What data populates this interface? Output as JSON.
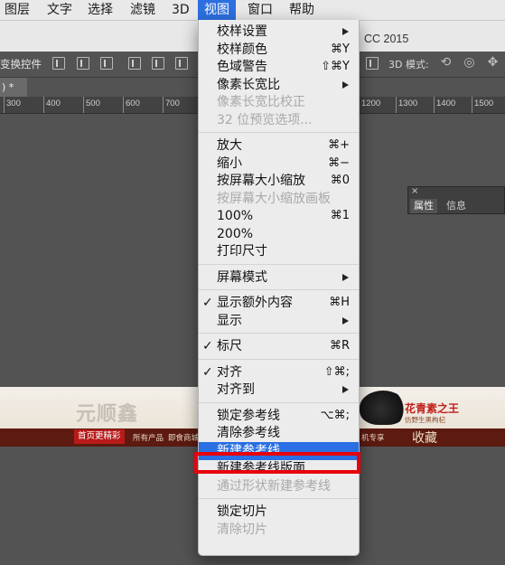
{
  "menubar": {
    "items": [
      "图层",
      "文字",
      "选择",
      "滤镜",
      "3D",
      "视图",
      "窗口",
      "帮助"
    ],
    "active_index": 5
  },
  "app_title": "CC 2015",
  "options_bar": {
    "transform_label": "变换控件",
    "mode3d_label": "3D 模式:"
  },
  "doc_tab": ") *",
  "ruler": {
    "labels": [
      "300",
      "400",
      "500",
      "600",
      "700",
      "1200",
      "1300",
      "1400",
      "1500"
    ]
  },
  "panel": {
    "tabs": [
      "属性",
      "信息"
    ],
    "active_index": 0,
    "close_glyph": "×"
  },
  "canvas_image": {
    "logo": "元顺鑫",
    "slogan": "花青素之王",
    "sub": "仿野生黑枸杞",
    "nav_first": "首页更精彩",
    "nav_links": [
      "所有产品",
      "即食商城",
      "机专享"
    ],
    "collect": "收藏"
  },
  "menu": {
    "items": [
      {
        "label": "校样设置",
        "submenu": true
      },
      {
        "label": "校样颜色",
        "shortcut": "⌘Y"
      },
      {
        "label": "色域警告",
        "shortcut": "⇧⌘Y"
      },
      {
        "label": "像素长宽比",
        "submenu": true
      },
      {
        "label": "像素长宽比校正",
        "disabled": true
      },
      {
        "label": "32 位预览选项...",
        "disabled": true
      },
      {
        "separator": true
      },
      {
        "label": "放大",
        "shortcut": "⌘+"
      },
      {
        "label": "缩小",
        "shortcut": "⌘−"
      },
      {
        "label": "按屏幕大小缩放",
        "shortcut": "⌘0"
      },
      {
        "label": "按屏幕大小缩放画板",
        "disabled": true
      },
      {
        "label": "100%",
        "shortcut": "⌘1"
      },
      {
        "label": "200%"
      },
      {
        "label": "打印尺寸"
      },
      {
        "separator": true
      },
      {
        "label": "屏幕模式",
        "submenu": true
      },
      {
        "separator": true
      },
      {
        "label": "显示额外内容",
        "shortcut": "⌘H",
        "checked": true
      },
      {
        "label": "显示",
        "submenu": true
      },
      {
        "separator": true
      },
      {
        "label": "标尺",
        "shortcut": "⌘R",
        "checked": true
      },
      {
        "separator": true
      },
      {
        "label": "对齐",
        "shortcut": "⇧⌘;",
        "checked": true
      },
      {
        "label": "对齐到",
        "submenu": true
      },
      {
        "separator": true
      },
      {
        "label": "锁定参考线",
        "shortcut": "⌥⌘;"
      },
      {
        "label": "清除参考线"
      },
      {
        "label": "新建参考线...",
        "highlighted": true
      },
      {
        "label": "新建参考线版面..."
      },
      {
        "label": "通过形状新建参考线",
        "disabled": true
      },
      {
        "separator": true
      },
      {
        "label": "锁定切片"
      },
      {
        "label": "清除切片",
        "disabled": true
      }
    ]
  }
}
